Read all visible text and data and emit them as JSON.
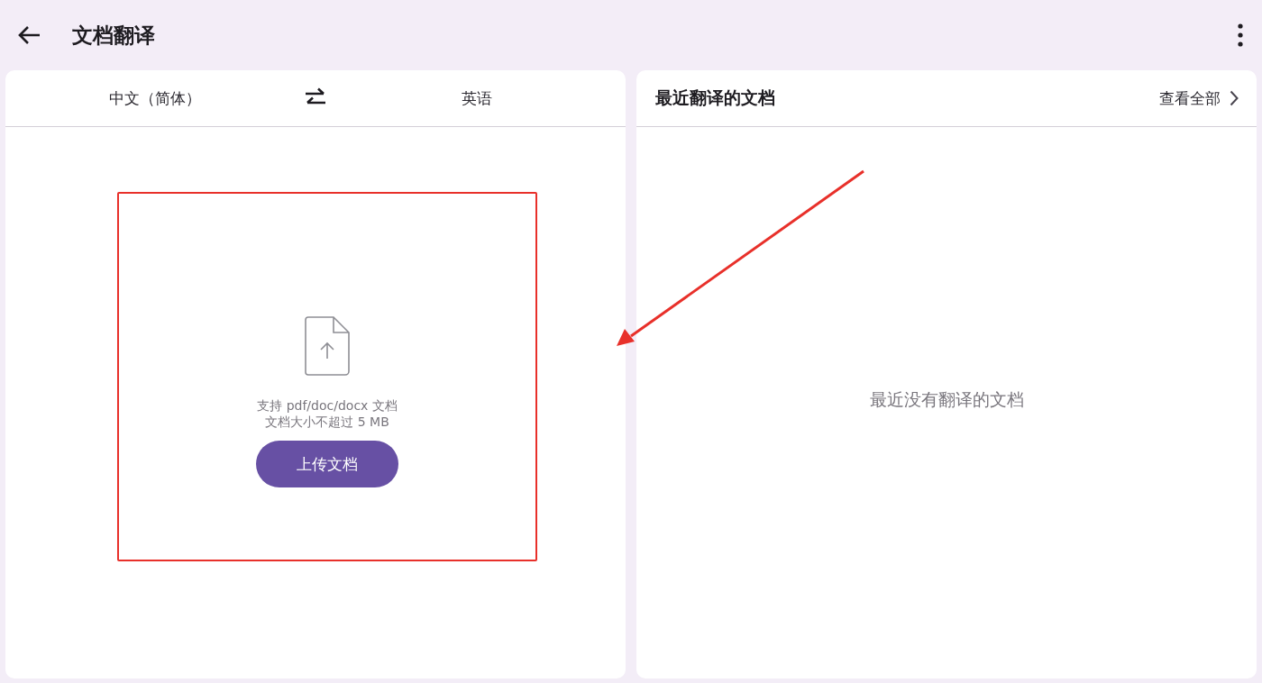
{
  "app_bar": {
    "title": "文档翻译"
  },
  "translate_panel": {
    "source_language": "中文（简体）",
    "target_language": "英语",
    "hint_lines": [
      "支持 pdf/doc/docx 文档",
      "文档大小不超过 5 MB"
    ],
    "upload_button": "上传文档"
  },
  "recent_panel": {
    "title": "最近翻译的文档",
    "view_all": "查看全部",
    "empty_message": "最近没有翻译的文档"
  }
}
